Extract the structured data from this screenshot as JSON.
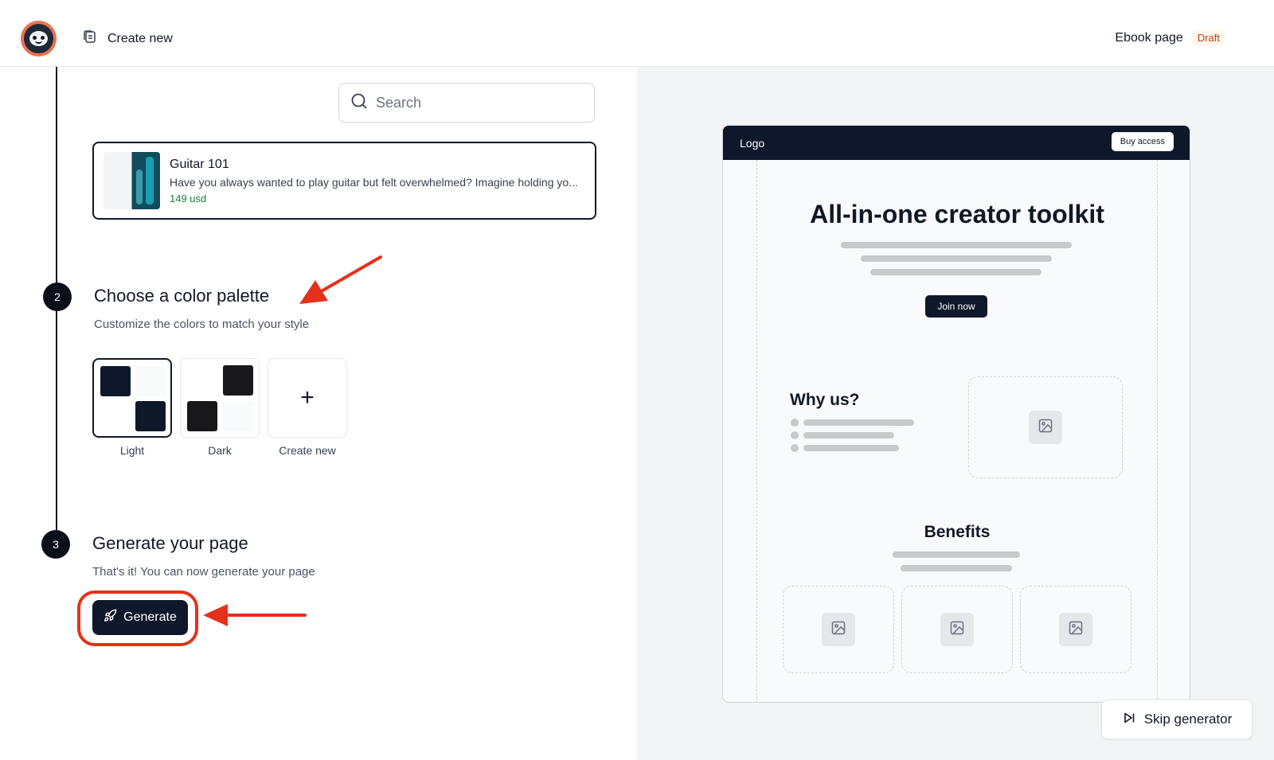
{
  "header": {
    "create_new_label": "Create new",
    "page_type_label": "Ebook page",
    "status_badge": "Draft"
  },
  "search": {
    "placeholder": "Search"
  },
  "product": {
    "title": "Guitar 101",
    "description": "Have you always wanted to play guitar but felt overwhelmed? Imagine holding yo...",
    "price": "149 usd"
  },
  "steps": [
    {
      "number": "2",
      "title": "Choose a color palette",
      "description": "Customize the colors to match your style"
    },
    {
      "number": "3",
      "title": "Generate your page",
      "description": "That's it! You can now generate your page"
    }
  ],
  "palettes": [
    {
      "label": "Light",
      "selected": true
    },
    {
      "label": "Dark",
      "selected": false
    },
    {
      "label": "Create new",
      "selected": false
    }
  ],
  "colors": {
    "accent_dark": "#0f172a",
    "annotation_red": "#e5311b",
    "price_green": "#15803d",
    "draft_orange": "#c2410c"
  },
  "generate_button_label": "Generate",
  "preview": {
    "logo": "Logo",
    "buy_button": "Buy access",
    "hero_title": "All-in-one creator toolkit",
    "join_button": "Join now",
    "why_title": "Why us?",
    "benefits_title": "Benefits"
  },
  "skip_button_label": "Skip generator"
}
